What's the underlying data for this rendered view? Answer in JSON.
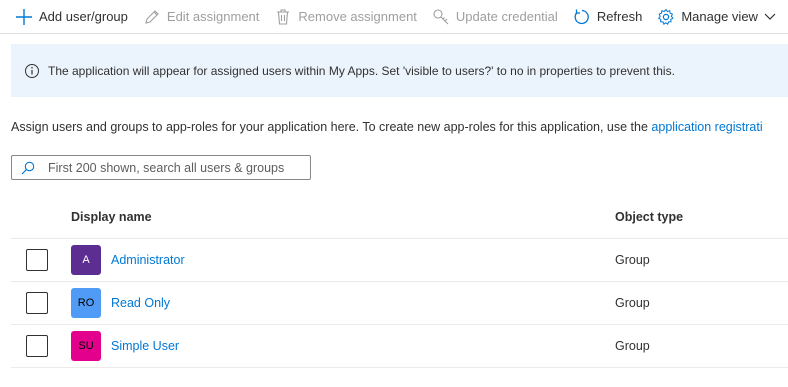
{
  "toolbar": {
    "add_label": "Add user/group",
    "edit_label": "Edit assignment",
    "remove_label": "Remove assignment",
    "update_label": "Update credential",
    "refresh_label": "Refresh",
    "manage_label": "Manage view"
  },
  "banner": {
    "text": "The application will appear for assigned users within My Apps. Set 'visible to users?' to no in properties to prevent this."
  },
  "description": {
    "text": "Assign users and groups to app-roles for your application here. To create new app-roles for this application, use the ",
    "link": "application registrati"
  },
  "search": {
    "placeholder": "First 200 shown, search all users & groups"
  },
  "table": {
    "headers": {
      "name": "Display name",
      "type": "Object type"
    },
    "rows": [
      {
        "initials": "A",
        "name": "Administrator",
        "type": "Group",
        "avatar_bg": "#5c2e91",
        "avatar_fg": "#ffffff"
      },
      {
        "initials": "RO",
        "name": "Read Only",
        "type": "Group",
        "avatar_bg": "#4f9bf5",
        "avatar_fg": "#000000"
      },
      {
        "initials": "SU",
        "name": "Simple User",
        "type": "Group",
        "avatar_bg": "#e3008c",
        "avatar_fg": "#000000"
      }
    ]
  },
  "colors": {
    "accent": "#0078d4",
    "banner_bg": "#ebf3fc",
    "disabled": "#a19f9d"
  },
  "icons": [
    "plus-icon",
    "pencil-icon",
    "trash-icon",
    "key-icon",
    "refresh-icon",
    "gear-icon",
    "chevron-down-icon",
    "info-icon",
    "search-icon"
  ]
}
